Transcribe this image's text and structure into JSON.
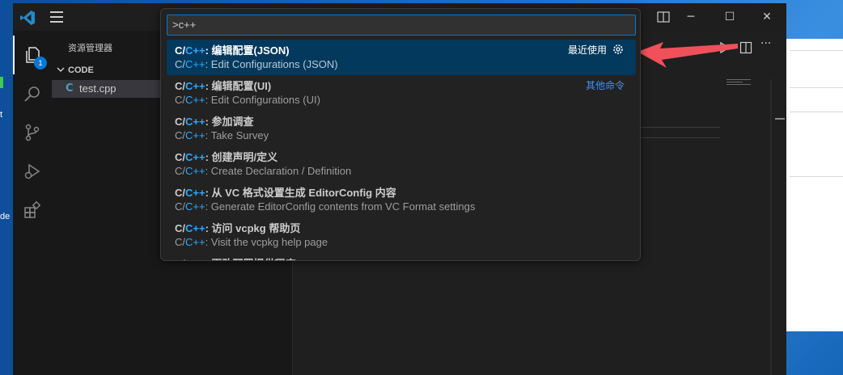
{
  "desktop": {
    "left_labels": [
      "t",
      "de"
    ]
  },
  "titlebar": {
    "window_controls": [
      "minimize",
      "maximize",
      "close"
    ]
  },
  "activity_bar": {
    "items": [
      "explorer-icon",
      "search-icon",
      "source-control-icon",
      "run-debug-icon",
      "extensions-icon"
    ],
    "explorer_badge": "1"
  },
  "sidebar": {
    "title": "资源管理器",
    "folder": "CODE",
    "file": "test.cpp",
    "file_icon": "C"
  },
  "quick_pick": {
    "input_value": ">c++",
    "items": [
      {
        "prefix": "C/",
        "match": "C++",
        "rest": ": 编辑配置(JSON)",
        "desc_prefix": "C/",
        "desc_match": "C++",
        "desc_rest": ": Edit Configurations (JSON)",
        "tag": "最近使用",
        "selected": true
      },
      {
        "prefix": "C/",
        "match": "C++",
        "rest": ": 编辑配置(UI)",
        "desc_prefix": "C/",
        "desc_match": "C++",
        "desc_rest": ": Edit Configurations (UI)",
        "tag": "其他命令"
      },
      {
        "prefix": "C/",
        "match": "C++",
        "rest": ": 参加调查",
        "desc_prefix": "C/",
        "desc_match": "C++",
        "desc_rest": ": Take Survey"
      },
      {
        "prefix": "C/",
        "match": "C++",
        "rest": ": 创建声明/定义",
        "desc_prefix": "C/",
        "desc_match": "C++",
        "desc_rest": ": Create Declaration / Definition"
      },
      {
        "prefix": "C/",
        "match": "C++",
        "rest": ": 从 VC 格式设置生成 EditorConfig 内容",
        "desc_prefix": "C/",
        "desc_match": "C++",
        "desc_rest": ": Generate EditorConfig contents from VC Format settings"
      },
      {
        "prefix": "C/",
        "match": "C++",
        "rest": ": 访问 vcpkg 帮助页",
        "desc_prefix": "C/",
        "desc_match": "C++",
        "desc_rest": ": Visit the vcpkg help page"
      },
      {
        "prefix": "C/",
        "match": "C++",
        "rest": ": 更改配置提供程序",
        "desc_prefix": "",
        "desc_match": "",
        "desc_rest": ""
      }
    ]
  },
  "colors": {
    "accent": "#0078d4",
    "match_highlight": "#2aaaff",
    "selected_bg": "#04395e",
    "annotation_arrow": "#f0505a"
  }
}
